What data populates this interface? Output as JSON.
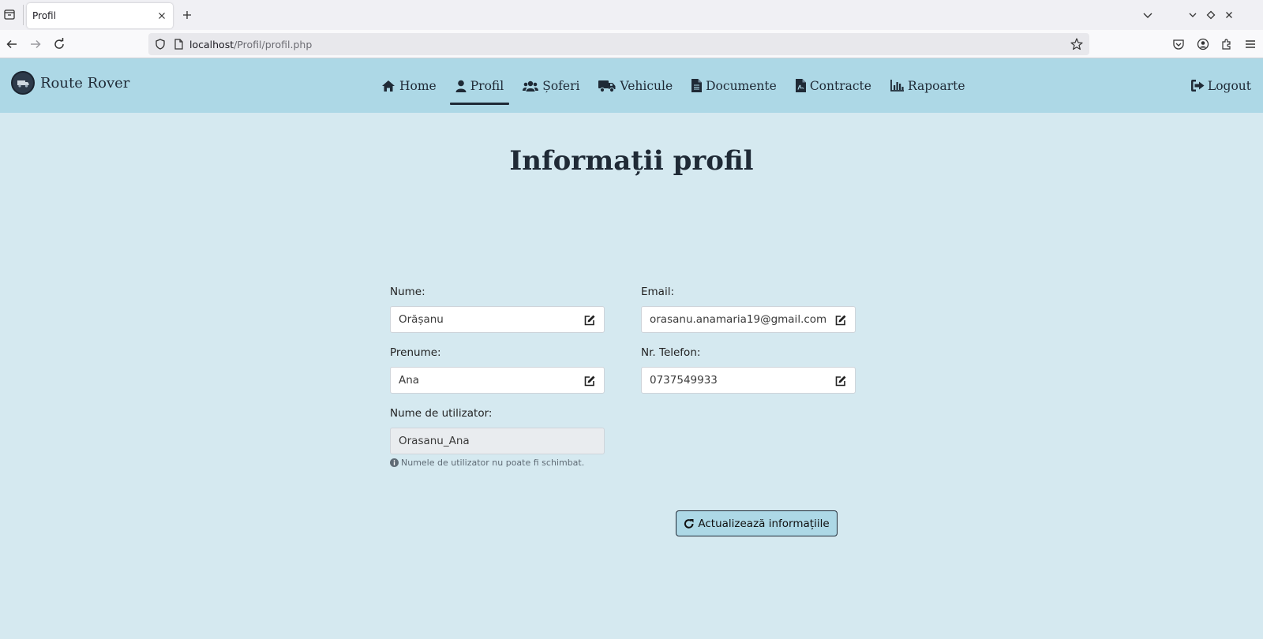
{
  "browser": {
    "tab_title": "Profil",
    "url_host": "localhost",
    "url_path": "/Profil/profil.php"
  },
  "app": {
    "brand": "Route Rover",
    "nav": [
      {
        "label": "Home",
        "icon": "home-icon"
      },
      {
        "label": "Profil",
        "icon": "user-icon",
        "active": true
      },
      {
        "label": "Șoferi",
        "icon": "users-icon"
      },
      {
        "label": "Vehicule",
        "icon": "truck-icon"
      },
      {
        "label": "Documente",
        "icon": "document-icon"
      },
      {
        "label": "Contracte",
        "icon": "contract-icon"
      },
      {
        "label": "Rapoarte",
        "icon": "chart-icon"
      }
    ],
    "logout": "Logout"
  },
  "page": {
    "title": "Informații profil"
  },
  "form": {
    "nume_label": "Nume:",
    "nume_value": "Orășanu",
    "prenume_label": "Prenume:",
    "prenume_value": "Ana",
    "username_label": "Nume de utilizator:",
    "username_value": "Orasanu_Ana",
    "username_hint": "Numele de utilizator nu poate fi schimbat.",
    "email_label": "Email:",
    "email_value": "orasanu.anamaria19@gmail.com",
    "telefon_label": "Nr. Telefon:",
    "telefon_value": "0737549933",
    "submit_label": "Actualizează informațiile"
  },
  "colors": {
    "header_bg": "#add8e6",
    "page_bg": "#d5e9f0",
    "text_dark": "#1f2a36"
  }
}
